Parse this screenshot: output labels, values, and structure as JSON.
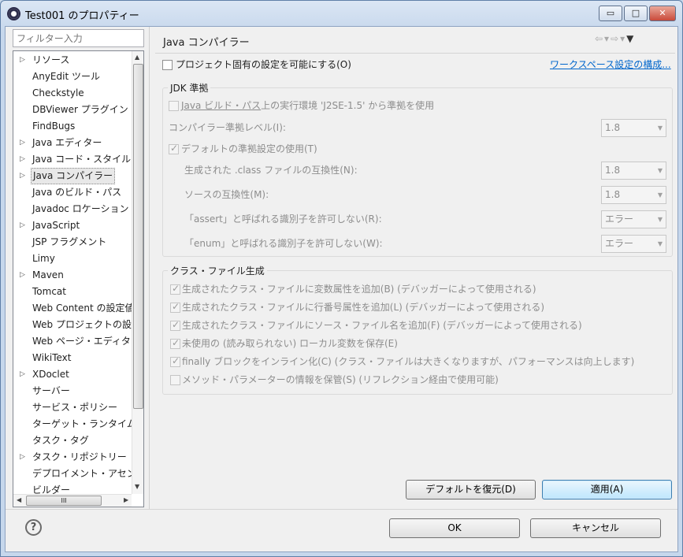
{
  "window": {
    "title": "Test001 のプロパティー",
    "minimize": "▭",
    "maximize": "□",
    "close": "✕"
  },
  "filter": {
    "placeholder": "フィルター入力"
  },
  "tree": {
    "items": [
      {
        "label": "リソース",
        "expandable": true
      },
      {
        "label": "AnyEdit ツール",
        "expandable": false
      },
      {
        "label": "Checkstyle",
        "expandable": false
      },
      {
        "label": "DBViewer プラグイン",
        "expandable": false
      },
      {
        "label": "FindBugs",
        "expandable": false
      },
      {
        "label": "Java エディター",
        "expandable": true
      },
      {
        "label": "Java コード・スタイル",
        "expandable": true
      },
      {
        "label": "Java コンパイラー",
        "expandable": true,
        "selected": true
      },
      {
        "label": "Java のビルド・パス",
        "expandable": false
      },
      {
        "label": "Javadoc ロケーション",
        "expandable": false
      },
      {
        "label": "JavaScript",
        "expandable": true
      },
      {
        "label": "JSP フラグメント",
        "expandable": false
      },
      {
        "label": "Limy",
        "expandable": false
      },
      {
        "label": "Maven",
        "expandable": true
      },
      {
        "label": "Tomcat",
        "expandable": false
      },
      {
        "label": "Web Content の設定値",
        "expandable": false
      },
      {
        "label": "Web プロジェクトの設",
        "expandable": false
      },
      {
        "label": "Web ページ・エディタ",
        "expandable": false
      },
      {
        "label": "WikiText",
        "expandable": false
      },
      {
        "label": "XDoclet",
        "expandable": true
      },
      {
        "label": "サーバー",
        "expandable": false
      },
      {
        "label": "サービス・ポリシー",
        "expandable": false
      },
      {
        "label": "ターゲット・ランタイム",
        "expandable": false
      },
      {
        "label": "タスク・タグ",
        "expandable": false
      },
      {
        "label": "タスク・リポジトリー",
        "expandable": true
      },
      {
        "label": "デプロイメント・アセン",
        "expandable": false
      },
      {
        "label": "ビルダー",
        "expandable": false
      }
    ],
    "hscroll_thumb": "III"
  },
  "page": {
    "title": "Java コンパイラー",
    "project_specific": "プロジェクト固有の設定を可能にする(O)",
    "workspace_link": "ワークスペース設定の構成...",
    "jdk_group": {
      "label": "JDK 準拠",
      "build_path_link": "Java ビルド・パス",
      "build_path_rest": "上の実行環境 'J2SE-1.5' から準拠を使用",
      "compliance_level_label": "コンパイラー準拠レベル(I):",
      "compliance_level_value": "1.8",
      "use_default": "デフォルトの準拠設定の使用(T)",
      "class_compat_label": "生成された .class ファイルの互換性(N):",
      "class_compat_value": "1.8",
      "source_compat_label": "ソースの互換性(M):",
      "source_compat_value": "1.8",
      "assert_label": "「assert」と呼ばれる識別子を許可しない(R):",
      "assert_value": "エラー",
      "enum_label": "「enum」と呼ばれる識別子を許可しない(W):",
      "enum_value": "エラー"
    },
    "classfile_group": {
      "label": "クラス・ファイル生成",
      "options": [
        {
          "label": "生成されたクラス・ファイルに変数属性を追加(B) (デバッガーによって使用される)",
          "checked": true
        },
        {
          "label": "生成されたクラス・ファイルに行番号属性を追加(L) (デバッガーによって使用される)",
          "checked": true
        },
        {
          "label": "生成されたクラス・ファイルにソース・ファイル名を追加(F) (デバッガーによって使用される)",
          "checked": true
        },
        {
          "label": "未使用の (読み取られない) ローカル変数を保存(E)",
          "checked": true
        },
        {
          "label": "finally ブロックをインライン化(C) (クラス・ファイルは大きくなりますが、パフォーマンスは向上します)",
          "checked": true
        },
        {
          "label": "メソッド・パラメーターの情報を保管(S) (リフレクション経由で使用可能)",
          "checked": false
        }
      ]
    },
    "restore_defaults": "デフォルトを復元(D)",
    "apply": "適用(A)"
  },
  "footer": {
    "ok": "OK",
    "cancel": "キャンセル",
    "help": "?"
  },
  "colors": {
    "link": "#0066cc",
    "disabled_text": "#8d8d8d",
    "title_bar": "#c6d7ec"
  }
}
